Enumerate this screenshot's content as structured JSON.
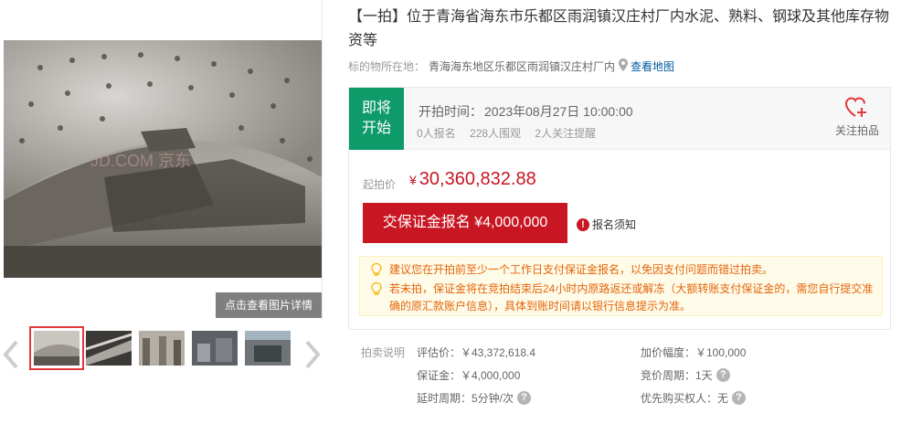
{
  "gallery": {
    "watermark": "JD.COM 京东",
    "detail_button": "点击查看图片详情",
    "thumbnails": [
      "mill-interior",
      "steel-pipes",
      "warehouse",
      "machinery",
      "workshop"
    ],
    "active_thumbnail": 0
  },
  "lot": {
    "title": "【一拍】位于青海省海东市乐都区雨润镇汉庄村厂内水泥、熟料、钢球及其他库存物资等",
    "location_label": "标的物所在地：",
    "location_value": "青海海东地区乐都区雨润镇汉庄村厂内",
    "map_link": "查看地图"
  },
  "auction": {
    "status_line1": "即将",
    "status_line2": "开始",
    "start_time_label": "开拍时间：",
    "start_time_value": "2023年08月27日 10:00:00",
    "signups": "0人报名",
    "watchers": "228人围观",
    "reminders": "2人关注提醒",
    "follow_label": "关注拍品",
    "starting_price_label": "起拍价",
    "starting_price_currency": "¥",
    "starting_price_value": "30,360,832.88",
    "deposit_button": "交保证金报名 ¥4,000,000",
    "notice_link": "报名须知",
    "tips": [
      "建议您在开拍前至少一个工作日支付保证金报名，以免因支付问题而错过拍卖。",
      "若未拍，保证金将在竞拍结束后24小时内原路返还或解冻（大额转账支付保证金的，需您自行提交准确的原汇款账户信息），具体到账时间请以银行信息提示为准。"
    ],
    "accent_color": "#c81623",
    "status_color": "#0f9a6a"
  },
  "info": {
    "section_label": "拍卖说明",
    "appraisal": "评估价：￥43,372,618.4",
    "increment": "加价幅度：￥100,000",
    "deposit": "保证金：￥4,000,000",
    "cycle": "竞价周期：1天",
    "delay": "延时周期：5分钟/次",
    "priority": "优先购买权人：无"
  }
}
